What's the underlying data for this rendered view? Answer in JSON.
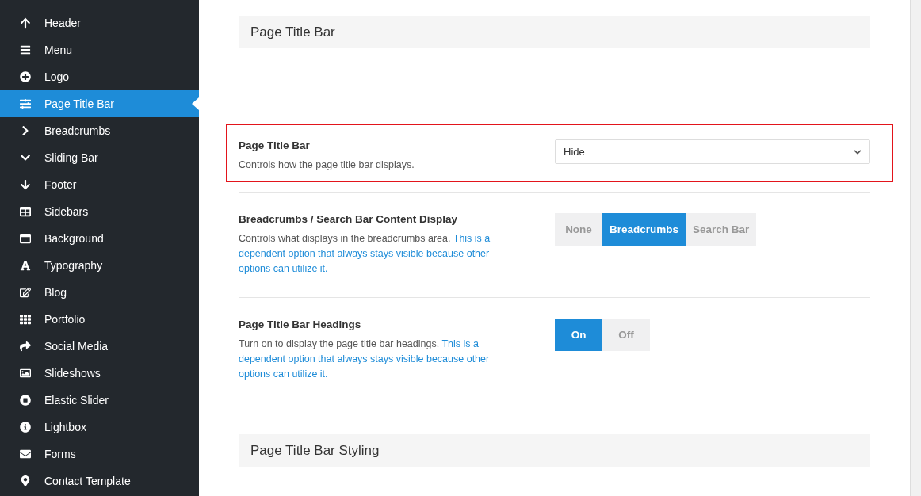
{
  "sidebar": {
    "items": [
      {
        "label": "Header",
        "selected": false
      },
      {
        "label": "Menu",
        "selected": false
      },
      {
        "label": "Logo",
        "selected": false
      },
      {
        "label": "Page Title Bar",
        "selected": true
      },
      {
        "label": "Breadcrumbs",
        "selected": false
      },
      {
        "label": "Sliding Bar",
        "selected": false
      },
      {
        "label": "Footer",
        "selected": false
      },
      {
        "label": "Sidebars",
        "selected": false
      },
      {
        "label": "Background",
        "selected": false
      },
      {
        "label": "Typography",
        "selected": false
      },
      {
        "label": "Blog",
        "selected": false
      },
      {
        "label": "Portfolio",
        "selected": false
      },
      {
        "label": "Social Media",
        "selected": false
      },
      {
        "label": "Slideshows",
        "selected": false
      },
      {
        "label": "Elastic Slider",
        "selected": false
      },
      {
        "label": "Lightbox",
        "selected": false
      },
      {
        "label": "Forms",
        "selected": false
      },
      {
        "label": "Contact Template",
        "selected": false
      }
    ]
  },
  "section_title": "Page Title Bar",
  "options": [
    {
      "kind": "select",
      "title": "Page Title Bar",
      "description": "Controls how the page title bar displays.",
      "value": "Hide",
      "highlighted": true
    },
    {
      "kind": "buttonset",
      "title": "Breadcrumbs / Search Bar Content Display",
      "description": "Controls what displays in the breadcrumbs area.",
      "note": "This is a dependent option that always stays visible because other options can utilize it.",
      "highlighted": false,
      "choices": [
        {
          "label": "None",
          "selected": false
        },
        {
          "label": "Breadcrumbs",
          "selected": true
        },
        {
          "label": "Search Bar",
          "selected": false
        }
      ]
    },
    {
      "kind": "buttonset",
      "title": "Page Title Bar Headings",
      "description": "Turn on to display the page title bar headings.",
      "note": "This is a dependent option that always stays visible because other options can utilize it.",
      "highlighted": false,
      "choices": [
        {
          "label": "On",
          "selected": true
        },
        {
          "label": "Off",
          "selected": false
        }
      ]
    }
  ],
  "next_section_title": "Page Title Bar Styling"
}
